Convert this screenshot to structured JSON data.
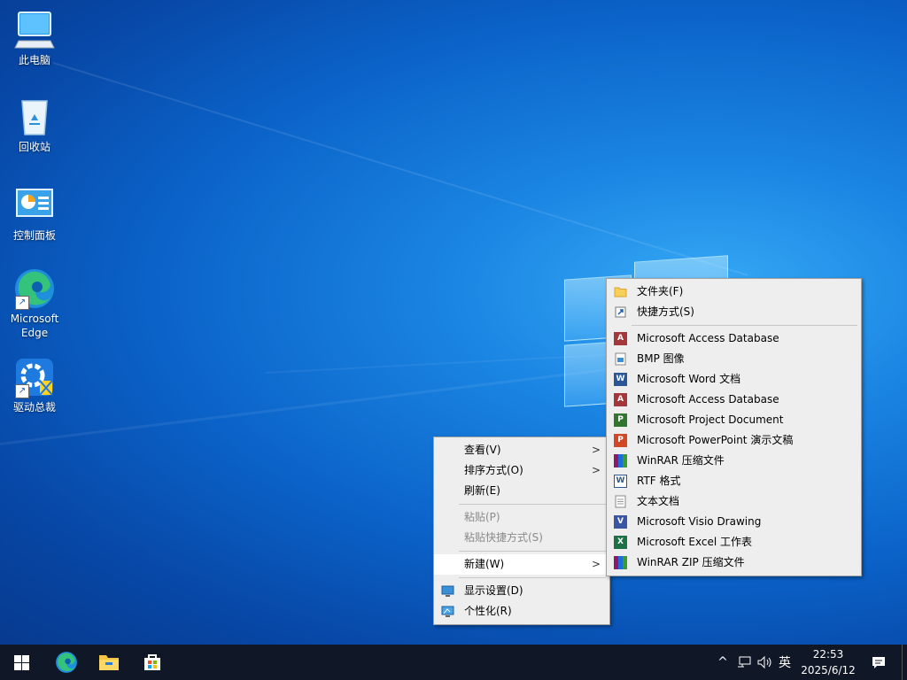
{
  "desktop": {
    "icons": [
      {
        "label": "此电脑"
      },
      {
        "label": "回收站"
      },
      {
        "label": "控制面板"
      },
      {
        "label": "Microsoft Edge"
      },
      {
        "label": "驱动总裁"
      }
    ]
  },
  "context_menu": {
    "items": [
      {
        "label": "查看(V)"
      },
      {
        "label": "排序方式(O)"
      },
      {
        "label": "刷新(E)"
      },
      {
        "label": "粘贴(P)"
      },
      {
        "label": "粘贴快捷方式(S)"
      },
      {
        "label": "新建(W)"
      },
      {
        "label": "显示设置(D)"
      },
      {
        "label": "个性化(R)"
      }
    ]
  },
  "new_submenu": {
    "items": [
      {
        "label": "文件夹(F)"
      },
      {
        "label": "快捷方式(S)"
      },
      {
        "label": "Microsoft Access Database"
      },
      {
        "label": "BMP 图像"
      },
      {
        "label": "Microsoft Word 文档"
      },
      {
        "label": "Microsoft Access Database"
      },
      {
        "label": "Microsoft Project Document"
      },
      {
        "label": "Microsoft PowerPoint 演示文稿"
      },
      {
        "label": "WinRAR 压缩文件"
      },
      {
        "label": "RTF 格式"
      },
      {
        "label": "文本文档"
      },
      {
        "label": "Microsoft Visio Drawing"
      },
      {
        "label": "Microsoft Excel 工作表"
      },
      {
        "label": "WinRAR ZIP 压缩文件"
      }
    ]
  },
  "taskbar": {
    "tray": {
      "chevron": "^",
      "ime_label": "英"
    },
    "clock": {
      "time": "22:53",
      "date": "2025/6/12"
    }
  },
  "accent_colors": {
    "desktop": "#0b63c9",
    "taskbar": "#101726",
    "menu": "#eeeeee"
  }
}
